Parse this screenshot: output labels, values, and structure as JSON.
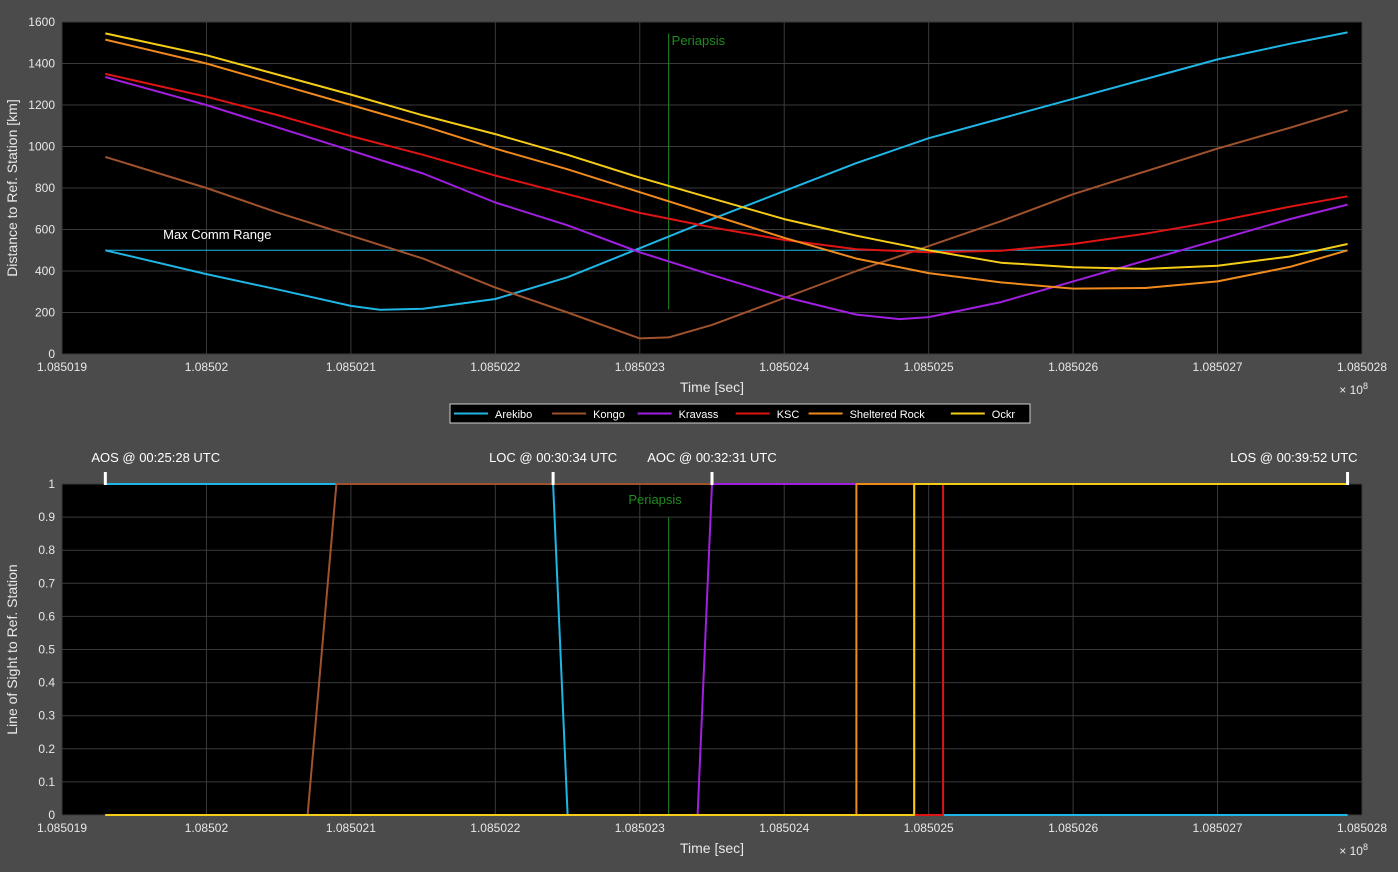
{
  "chart_data": [
    {
      "type": "line",
      "id": "distance",
      "xlabel": "Time [sec]",
      "ylabel": "Distance to Ref. Station [km]",
      "xlim": [
        1.085019,
        1.085028
      ],
      "ylim": [
        0,
        1600
      ],
      "x_multiplier": "× 10",
      "x_multiplier_exp": "8",
      "x_ticks": [
        "1.085019",
        "1.08502",
        "1.085021",
        "1.085022",
        "1.085023",
        "1.085024",
        "1.085025",
        "1.085026",
        "1.085027",
        "1.085028"
      ],
      "y_ticks": [
        "0",
        "200",
        "400",
        "600",
        "800",
        "1000",
        "1200",
        "1400",
        "1600"
      ],
      "grid": true,
      "series": [
        {
          "name": "Arekibo",
          "color": "#1fb6e6",
          "points": [
            [
              1.0850193,
              500
            ],
            [
              1.08502,
              385
            ],
            [
              1.0850205,
              310
            ],
            [
              1.085021,
              232
            ],
            [
              1.0850212,
              213
            ],
            [
              1.0850215,
              218
            ],
            [
              1.085022,
              265
            ],
            [
              1.0850225,
              370
            ],
            [
              1.085023,
              510
            ],
            [
              1.0850235,
              650
            ],
            [
              1.085024,
              785
            ],
            [
              1.0850245,
              920
            ],
            [
              1.085025,
              1040
            ],
            [
              1.0850255,
              1135
            ],
            [
              1.085026,
              1230
            ],
            [
              1.0850265,
              1325
            ],
            [
              1.085027,
              1420
            ],
            [
              1.0850275,
              1495
            ],
            [
              1.0850279,
              1550
            ]
          ]
        },
        {
          "name": "Kongo",
          "color": "#a0522d",
          "points": [
            [
              1.0850193,
              950
            ],
            [
              1.08502,
              800
            ],
            [
              1.0850205,
              680
            ],
            [
              1.085021,
              570
            ],
            [
              1.0850215,
              460
            ],
            [
              1.085022,
              320
            ],
            [
              1.0850225,
              200
            ],
            [
              1.085023,
              75
            ],
            [
              1.0850232,
              80
            ],
            [
              1.0850235,
              140
            ],
            [
              1.085024,
              270
            ],
            [
              1.0850245,
              400
            ],
            [
              1.085025,
              520
            ],
            [
              1.0850255,
              640
            ],
            [
              1.085026,
              770
            ],
            [
              1.0850265,
              880
            ],
            [
              1.085027,
              990
            ],
            [
              1.0850275,
              1090
            ],
            [
              1.0850279,
              1175
            ]
          ]
        },
        {
          "name": "Kravass",
          "color": "#a11fe0",
          "points": [
            [
              1.0850193,
              1335
            ],
            [
              1.08502,
              1200
            ],
            [
              1.0850205,
              1090
            ],
            [
              1.085021,
              980
            ],
            [
              1.0850215,
              870
            ],
            [
              1.085022,
              730
            ],
            [
              1.0850225,
              620
            ],
            [
              1.085023,
              490
            ],
            [
              1.0850235,
              380
            ],
            [
              1.085024,
              275
            ],
            [
              1.0850245,
              190
            ],
            [
              1.0850248,
              168
            ],
            [
              1.085025,
              178
            ],
            [
              1.0850255,
              250
            ],
            [
              1.085026,
              350
            ],
            [
              1.0850265,
              450
            ],
            [
              1.085027,
              550
            ],
            [
              1.0850275,
              650
            ],
            [
              1.0850279,
              720
            ]
          ]
        },
        {
          "name": "KSC",
          "color": "#e01414",
          "points": [
            [
              1.0850193,
              1350
            ],
            [
              1.08502,
              1240
            ],
            [
              1.0850205,
              1150
            ],
            [
              1.085021,
              1050
            ],
            [
              1.0850215,
              960
            ],
            [
              1.085022,
              860
            ],
            [
              1.0850225,
              770
            ],
            [
              1.085023,
              680
            ],
            [
              1.0850235,
              610
            ],
            [
              1.085024,
              550
            ],
            [
              1.0850245,
              505
            ],
            [
              1.085025,
              490
            ],
            [
              1.0850255,
              498
            ],
            [
              1.085026,
              530
            ],
            [
              1.0850265,
              580
            ],
            [
              1.085027,
              640
            ],
            [
              1.0850275,
              710
            ],
            [
              1.0850279,
              760
            ]
          ]
        },
        {
          "name": "Sheltered Rock",
          "color": "#ef8a1d",
          "points": [
            [
              1.0850193,
              1515
            ],
            [
              1.08502,
              1400
            ],
            [
              1.0850205,
              1300
            ],
            [
              1.085021,
              1200
            ],
            [
              1.0850215,
              1100
            ],
            [
              1.085022,
              990
            ],
            [
              1.0850225,
              890
            ],
            [
              1.085023,
              780
            ],
            [
              1.0850235,
              670
            ],
            [
              1.085024,
              560
            ],
            [
              1.0850245,
              460
            ],
            [
              1.085025,
              390
            ],
            [
              1.0850255,
              345
            ],
            [
              1.085026,
              315
            ],
            [
              1.0850265,
              318
            ],
            [
              1.085027,
              350
            ],
            [
              1.0850275,
              420
            ],
            [
              1.0850279,
              500
            ]
          ]
        },
        {
          "name": "Ockr",
          "color": "#f5cd18",
          "points": [
            [
              1.0850193,
              1545
            ],
            [
              1.08502,
              1440
            ],
            [
              1.0850205,
              1345
            ],
            [
              1.085021,
              1250
            ],
            [
              1.0850215,
              1150
            ],
            [
              1.085022,
              1060
            ],
            [
              1.0850225,
              960
            ],
            [
              1.085023,
              850
            ],
            [
              1.0850235,
              750
            ],
            [
              1.085024,
              650
            ],
            [
              1.0850245,
              570
            ],
            [
              1.085025,
              500
            ],
            [
              1.0850255,
              440
            ],
            [
              1.085026,
              418
            ],
            [
              1.0850265,
              410
            ],
            [
              1.085027,
              425
            ],
            [
              1.0850275,
              470
            ],
            [
              1.0850279,
              530
            ]
          ]
        }
      ],
      "annotations": [
        {
          "kind": "hline",
          "y": 500,
          "x_from": 1.0850193,
          "x_to": 1.0850279,
          "color": "#1fb6e6",
          "label": "Max Comm Range",
          "label_x": 1.0850197,
          "label_y": 555
        },
        {
          "kind": "vline",
          "x": 1.0850232,
          "y_from": 215,
          "y_to": 1545,
          "color": "#1e8c1e",
          "label": "Periapsis",
          "label_x": 1.0850232,
          "label_y": 1490
        }
      ]
    },
    {
      "type": "line",
      "id": "los",
      "xlabel": "Time [sec]",
      "ylabel": "Line of Sight to Ref. Station",
      "xlim": [
        1.085019,
        1.085028
      ],
      "ylim": [
        0,
        1
      ],
      "x_multiplier": "× 10",
      "x_multiplier_exp": "8",
      "x_ticks": [
        "1.085019",
        "1.08502",
        "1.085021",
        "1.085022",
        "1.085023",
        "1.085024",
        "1.085025",
        "1.085026",
        "1.085027",
        "1.085028"
      ],
      "y_ticks": [
        "0",
        "0.1",
        "0.2",
        "0.3",
        "0.4",
        "0.5",
        "0.6",
        "0.7",
        "0.8",
        "0.9",
        "1"
      ],
      "grid": true,
      "series": [
        {
          "name": "Arekibo",
          "color": "#1fb6e6",
          "points": [
            [
              1.0850193,
              1
            ],
            [
              1.0850224,
              1
            ],
            [
              1.0850225,
              0
            ],
            [
              1.0850279,
              0
            ]
          ]
        },
        {
          "name": "Kongo",
          "color": "#a0522d",
          "points": [
            [
              1.0850193,
              0
            ],
            [
              1.0850207,
              0
            ],
            [
              1.0850209,
              1
            ],
            [
              1.0850249,
              1
            ],
            [
              1.0850249,
              0
            ],
            [
              1.0850249,
              1
            ],
            [
              1.0850279,
              1
            ]
          ]
        },
        {
          "name": "Kravass",
          "color": "#a11fe0",
          "points": [
            [
              1.0850193,
              0
            ],
            [
              1.0850234,
              0
            ],
            [
              1.0850235,
              1
            ],
            [
              1.0850279,
              1
            ]
          ]
        },
        {
          "name": "KSC",
          "color": "#e01414",
          "points": [
            [
              1.0850193,
              0
            ],
            [
              1.0850251,
              0
            ],
            [
              1.0850251,
              1
            ],
            [
              1.0850279,
              1
            ]
          ]
        },
        {
          "name": "Sheltered Rock",
          "color": "#ef8a1d",
          "points": [
            [
              1.0850193,
              0
            ],
            [
              1.0850245,
              0
            ],
            [
              1.0850245,
              1
            ],
            [
              1.0850279,
              1
            ]
          ]
        },
        {
          "name": "Ockr",
          "color": "#f5cd18",
          "points": [
            [
              1.0850193,
              0
            ],
            [
              1.0850249,
              0
            ],
            [
              1.0850249,
              1
            ],
            [
              1.0850279,
              1
            ]
          ]
        }
      ],
      "annotations": [
        {
          "kind": "vline",
          "x": 1.0850232,
          "y_from": 0,
          "y_to": 0.9,
          "color": "#1e8c1e",
          "label": "Periapsis",
          "label_x": 1.0850229,
          "label_y": 0.94
        }
      ],
      "event_markers": [
        {
          "label": "AOS @ 00:25:28 UTC",
          "x": 1.0850193,
          "label_anchor": "start"
        },
        {
          "label": "LOC @ 00:30:34 UTC",
          "x": 1.0850224,
          "label_anchor": "middle"
        },
        {
          "label": "AOC @ 00:32:31 UTC",
          "x": 1.0850235,
          "label_anchor": "middle"
        },
        {
          "label": "LOS @ 00:39:52 UTC",
          "x": 1.0850279,
          "label_anchor": "end"
        }
      ]
    }
  ],
  "legend": {
    "placement": "between-plots",
    "entries": [
      {
        "name": "Arekibo",
        "color": "#1fb6e6"
      },
      {
        "name": "Kongo",
        "color": "#a0522d"
      },
      {
        "name": "Kravass",
        "color": "#a11fe0"
      },
      {
        "name": "KSC",
        "color": "#e01414"
      },
      {
        "name": "Sheltered Rock",
        "color": "#ef8a1d"
      },
      {
        "name": "Ockr",
        "color": "#f5cd18"
      }
    ]
  }
}
